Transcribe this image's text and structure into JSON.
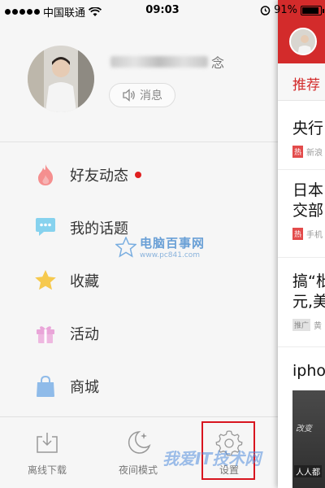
{
  "status_bar": {
    "carrier": "中国联通",
    "time": "09:03",
    "battery": "91%",
    "battery_level": 0.91
  },
  "profile": {
    "name_suffix": "念",
    "message_button": "消息"
  },
  "menu": [
    {
      "label": "好友动态",
      "icon": "flame-icon",
      "color": "#f36d6d",
      "has_dot": true
    },
    {
      "label": "我的话题",
      "icon": "chat-bubble-icon",
      "color": "#7fcdea",
      "has_dot": false
    },
    {
      "label": "收藏",
      "icon": "star-icon",
      "color": "#f5c342",
      "has_dot": false
    },
    {
      "label": "活动",
      "icon": "gift-icon",
      "color": "#e79bd4",
      "has_dot": false
    },
    {
      "label": "商城",
      "icon": "shopping-bag-icon",
      "color": "#8ab8e8",
      "has_dot": false
    }
  ],
  "bottom_bar": {
    "offline": "离线下载",
    "night": "夜间模式",
    "settings": "设置"
  },
  "watermarks": {
    "site_title": "电脑百事网",
    "site_url": "www.pc841.com",
    "bottom_text": "我爱IT技术网"
  },
  "feed": {
    "tab_label": "推荐",
    "items": [
      {
        "headline": "央行",
        "tag": "热",
        "tag_type": "hot",
        "source": "新浪"
      },
      {
        "headline": "日本",
        "headline2": "交部",
        "tag": "热",
        "tag_type": "hot",
        "source": "手机"
      },
      {
        "headline": "搞“枇",
        "headline2": "元,美",
        "tag": "推广",
        "tag_type": "ad",
        "source": "黄"
      },
      {
        "headline": "iphon"
      }
    ],
    "image_caption": "改变",
    "image_overlay": "人人都"
  },
  "colors": {
    "accent_red": "#d32b2b",
    "highlight_box": "#d8151f"
  }
}
